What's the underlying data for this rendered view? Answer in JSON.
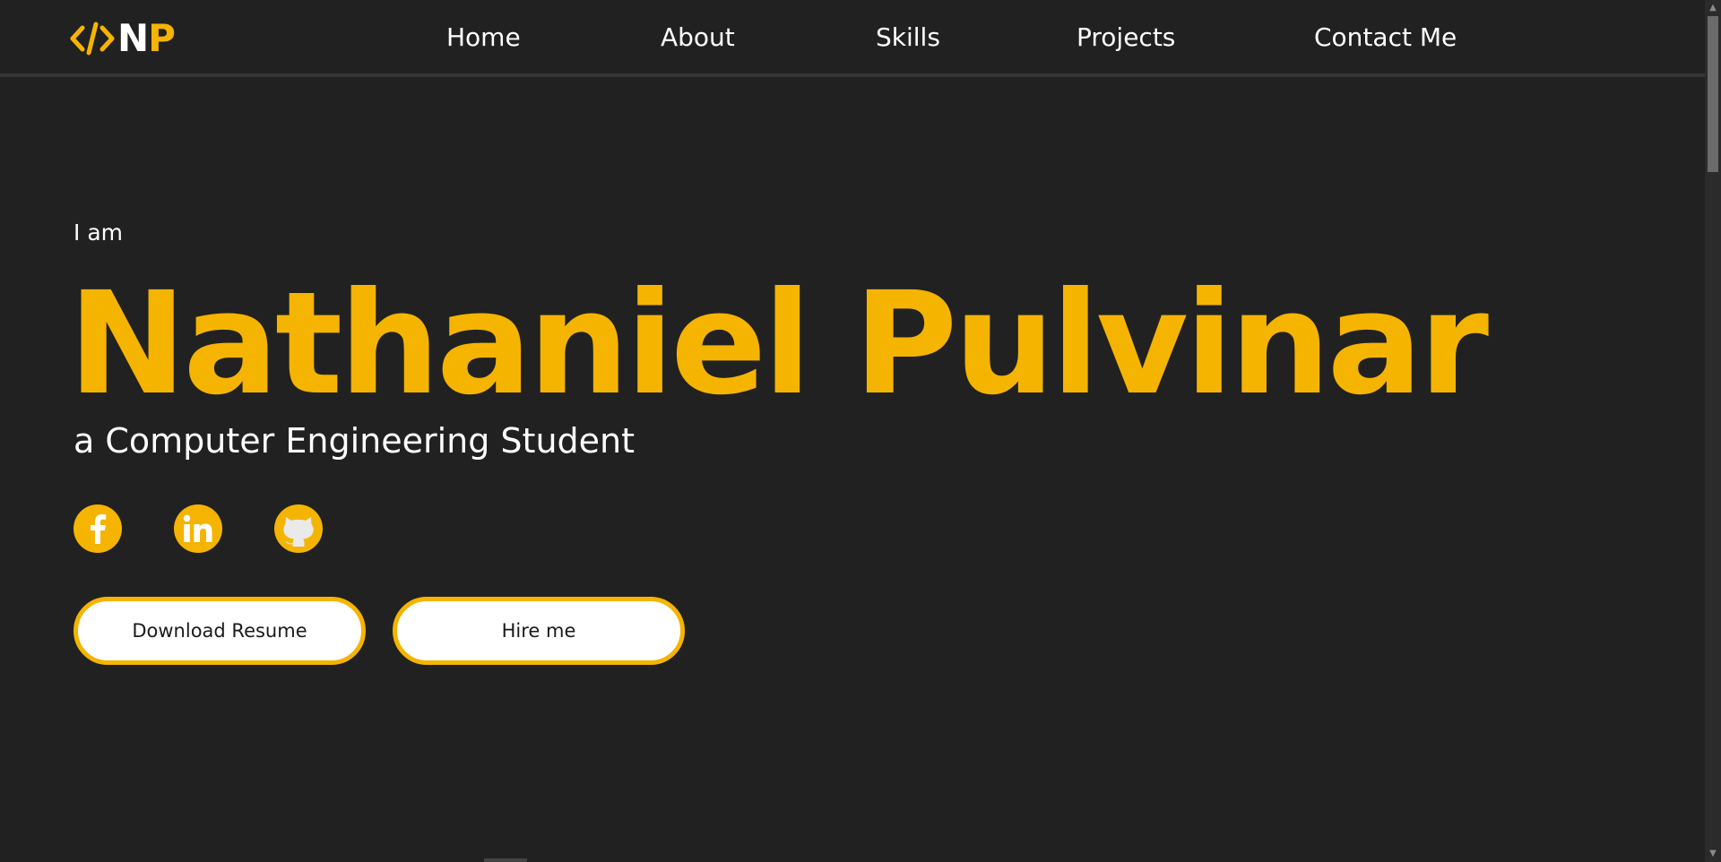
{
  "nav": {
    "logo": {
      "icon": "code-brackets-icon",
      "initial_n": "N",
      "initial_p": "P"
    },
    "links": [
      {
        "label": "Home"
      },
      {
        "label": "About"
      },
      {
        "label": "Skills"
      },
      {
        "label": "Projects"
      },
      {
        "label": "Contact Me"
      }
    ]
  },
  "hero": {
    "intro": "I am",
    "name": "Nathaniel Pulvinar",
    "role": "a Computer Engineering Student",
    "socials": [
      {
        "icon": "facebook-icon"
      },
      {
        "icon": "linkedin-icon"
      },
      {
        "icon": "github-icon"
      }
    ],
    "buttons": {
      "resume": "Download Resume",
      "hire": "Hire me"
    }
  },
  "colors": {
    "background": "#212121",
    "accent": "#f5b400",
    "text": "#ffffff",
    "button_bg": "#ffffff",
    "button_text": "#1a1a1a",
    "nav_border": "#363636"
  }
}
